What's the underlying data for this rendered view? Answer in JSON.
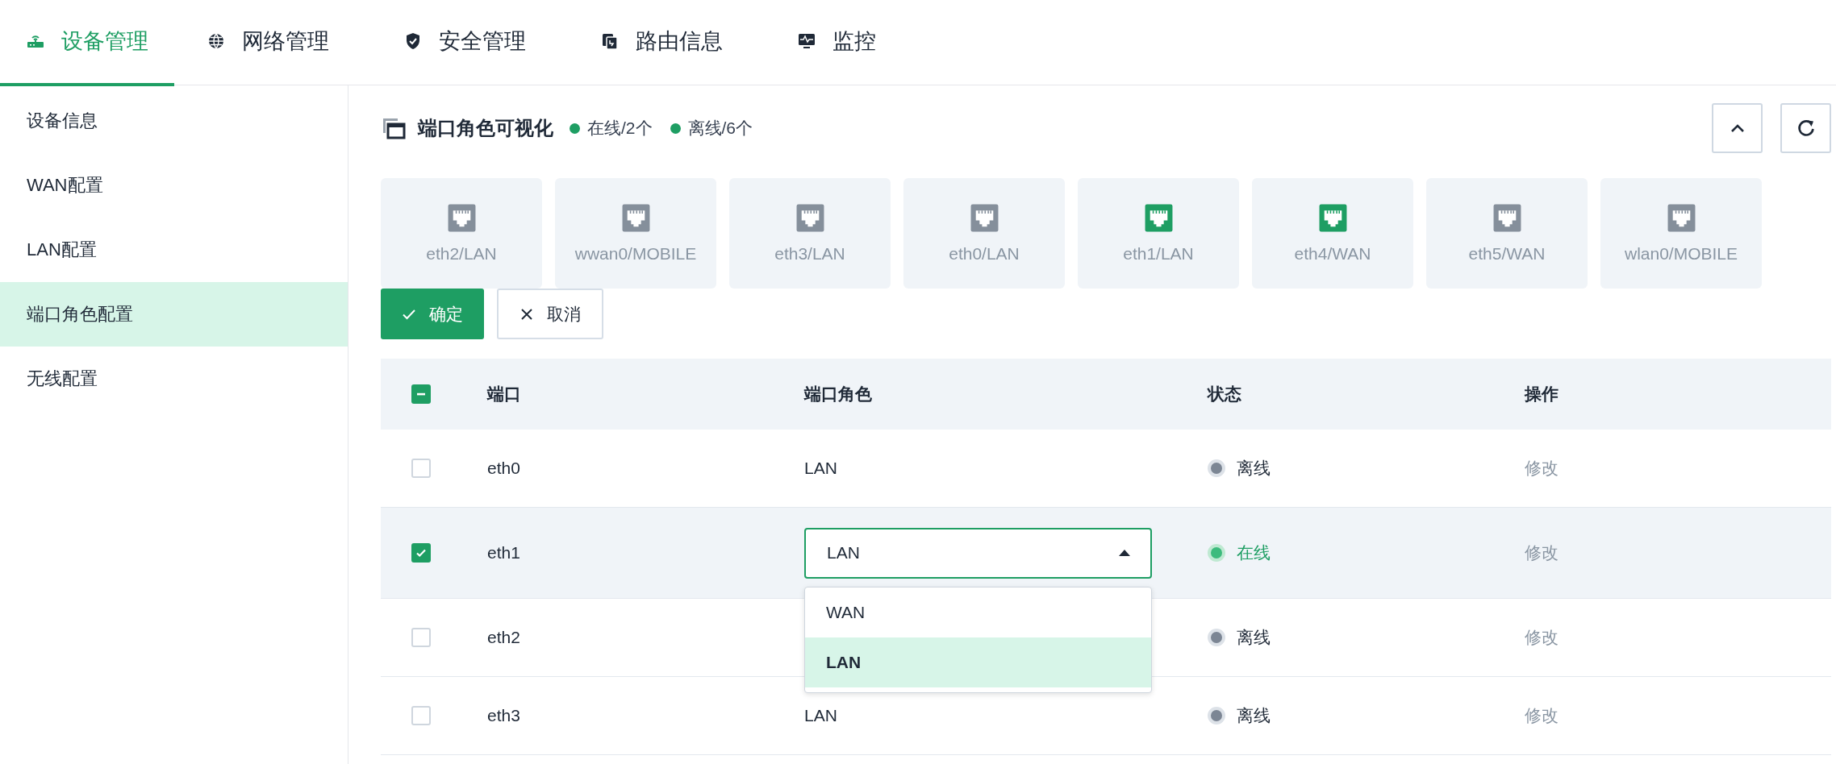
{
  "nav_tabs": [
    {
      "label": "设备管理",
      "kind": "router",
      "selected": true
    },
    {
      "label": "网络管理",
      "kind": "globe",
      "selected": false
    },
    {
      "label": "安全管理",
      "kind": "shield",
      "selected": false
    },
    {
      "label": "路由信息",
      "kind": "copy",
      "selected": false
    },
    {
      "label": "监控",
      "kind": "monitor",
      "selected": false
    }
  ],
  "sidebar": {
    "items": [
      {
        "label": "设备信息",
        "selected": false
      },
      {
        "label": "WAN配置",
        "selected": false
      },
      {
        "label": "LAN配置",
        "selected": false
      },
      {
        "label": "端口角色配置",
        "selected": true
      },
      {
        "label": "无线配置",
        "selected": false
      }
    ]
  },
  "panel": {
    "title": "端口角色可视化",
    "legend": [
      {
        "label": "在线/2个",
        "color": "#1e9e63"
      },
      {
        "label": "离线/6个",
        "color": "#1e9e63"
      }
    ],
    "ports": [
      {
        "label": "eth2/LAN",
        "online": false
      },
      {
        "label": "wwan0/MOBILE",
        "online": false
      },
      {
        "label": "eth3/LAN",
        "online": false
      },
      {
        "label": "eth0/LAN",
        "online": false
      },
      {
        "label": "eth1/LAN",
        "online": true
      },
      {
        "label": "eth4/WAN",
        "online": true
      },
      {
        "label": "eth5/WAN",
        "online": false
      },
      {
        "label": "wlan0/MOBILE",
        "online": false
      }
    ],
    "confirm_button": "确定",
    "cancel_button": "取消"
  },
  "table": {
    "select_all": {
      "indeterminate": true
    },
    "columns": [
      "端口",
      "端口角色",
      "状态",
      "操作"
    ],
    "rows": [
      {
        "port": "eth0",
        "role": "LAN",
        "status": "离线",
        "online": false,
        "selected": false,
        "action": "修改"
      },
      {
        "port": "eth1",
        "role_select": {
          "value": "LAN",
          "expanded": true,
          "options": [
            {
              "label": "WAN",
              "selected": false
            },
            {
              "label": "LAN",
              "selected": true
            }
          ]
        },
        "status": "在线",
        "online": true,
        "selected": true,
        "action": "修改"
      },
      {
        "port": "eth2",
        "status": "离线",
        "online": false,
        "selected": false,
        "action": "修改"
      },
      {
        "port": "eth3",
        "role": "LAN",
        "status": "离线",
        "online": false,
        "selected": false,
        "action": "修改"
      }
    ]
  }
}
